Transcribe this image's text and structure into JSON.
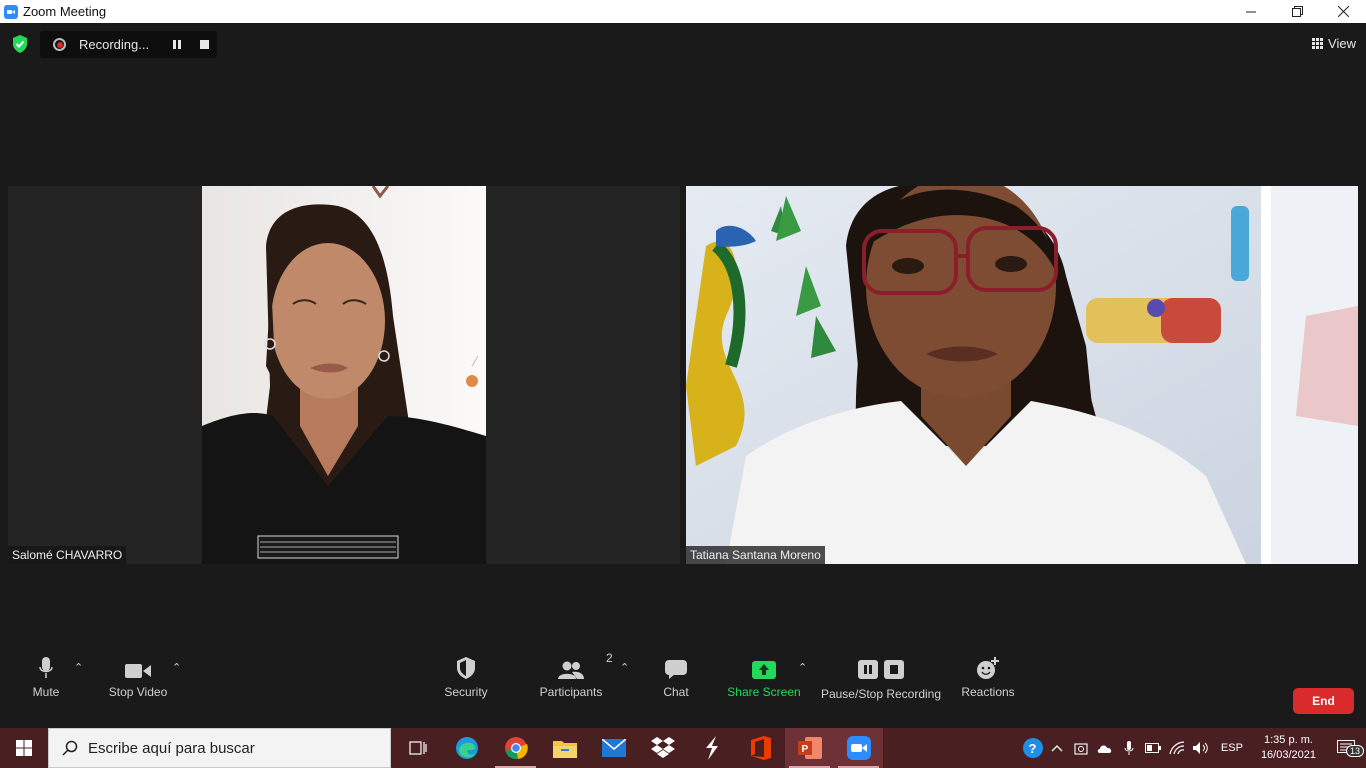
{
  "window": {
    "title": "Zoom Meeting",
    "controls": [
      "minimize",
      "maximize",
      "close"
    ]
  },
  "recording": {
    "status": "Recording..."
  },
  "view_label": "View",
  "participants": [
    {
      "name": "Salomé CHAVARRO"
    },
    {
      "name": "Tatiana Santana Moreno"
    }
  ],
  "toolbar": {
    "mute": "Mute",
    "stop_video": "Stop Video",
    "security": "Security",
    "participants": "Participants",
    "participants_count": "2",
    "chat": "Chat",
    "share_screen": "Share Screen",
    "pause_stop_recording": "Pause/Stop Recording",
    "reactions": "Reactions",
    "end": "End"
  },
  "colors": {
    "accent_green": "#23d959",
    "end_red": "#d92b2b",
    "record_red": "#e02828",
    "taskbar": "#4a1f22"
  },
  "taskbar": {
    "search_placeholder": "Escribe aquí para buscar",
    "apps": [
      "task-view-icon",
      "edge-icon",
      "chrome-icon",
      "file-explorer-icon",
      "mail-icon",
      "dropbox-icon",
      "kite-icon",
      "office-icon",
      "powerpoint-icon",
      "zoom-icon"
    ],
    "language": "ESP",
    "time": "1:35 p. m.",
    "date": "16/03/2021",
    "notifications_count": "13"
  }
}
